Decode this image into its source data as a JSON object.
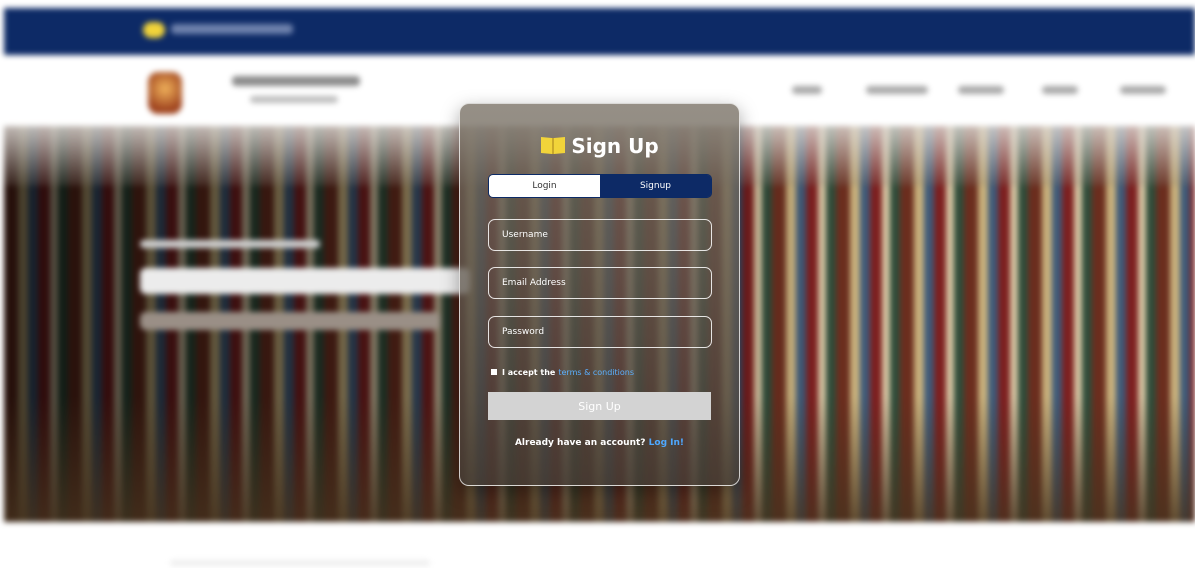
{
  "signup_card": {
    "title": "Sign Up",
    "title_icon": "open-book-icon",
    "tabs": [
      {
        "label": "Login",
        "active": false
      },
      {
        "label": "Signup",
        "active": true
      }
    ],
    "fields": {
      "username_placeholder": "Username",
      "email_placeholder": "Email Address",
      "password_placeholder": "Password"
    },
    "terms_prefix": "I accept the",
    "terms_link": "terms & conditions",
    "submit_label": "Sign Up",
    "footer_prefix": "Already have an account?",
    "footer_link": "Log In!"
  },
  "colors": {
    "header_navy": "#0d2a66",
    "accent_yellow": "#f1d43a",
    "link_blue": "#4ea8ff",
    "submit_gray": "#d3d3d3"
  }
}
